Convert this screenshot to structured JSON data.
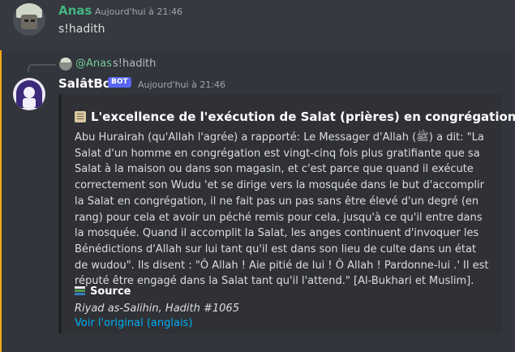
{
  "message1": {
    "author": "Anas",
    "author_color": "#43b581",
    "timestamp": "Aujourd'hui à 21:46",
    "content": "s!hadith"
  },
  "message2": {
    "reply": {
      "mention": "@Anas",
      "mention_color": "#72ca9a",
      "text": "s!hadith"
    },
    "author": "SalâtBot",
    "badge": "BOT",
    "badge_color": "#5865f2",
    "timestamp": "Aujourd'hui à 21:46",
    "embed": {
      "title_icon": "scroll-icon",
      "title": "L'excellence de l'exécution de Salat (prières) en congrégation",
      "description": "Abu Hurairah (qu'Allah l'agrée) a rapporté: Le Messager d'Allah (ﷺ) a dit: \"La Salat d'un homme en congrégation est vingt-cinq fois plus gratifiante que sa Salat à la maison ou dans son magasin, et c'est parce que quand il exécute correctement son Wudu 'et se dirige vers la mosquée dans le but d'accomplir la Salat en congrégation, il ne fait pas un pas sans être élevé d'un degré (en rang) pour cela et avoir un péché remis pour cela, jusqu'à ce qu'il entre dans la mosquée. Quand il accomplit la Salat, les anges continuent d'invoquer les Bénédictions d'Allah sur lui tant qu'il est dans son lieu de culte dans un état de wudou\". Ils disent : \"Ô Allah ! Aie pitié de lui ! Ô Allah ! Pardonne-lui .' Il est réputé être engagé dans la Salat tant qu'il l'attend.\" [Al-Bukhari et Muslim].",
      "field": {
        "icon": "books-icon",
        "name": "Source",
        "value": "Riyad as-Salihin, Hadith #1065",
        "link": "Voir l'original (anglais)",
        "link_color": "#00aff4"
      }
    }
  }
}
